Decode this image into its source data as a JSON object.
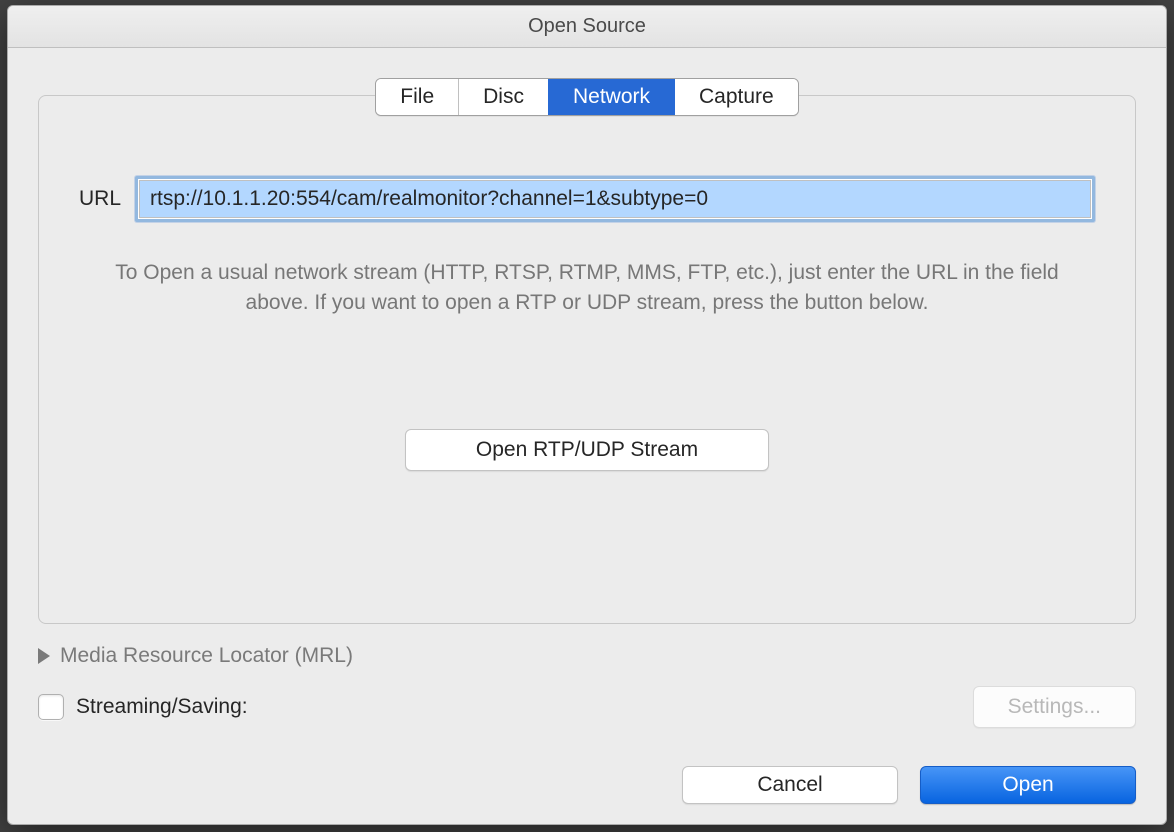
{
  "window": {
    "title": "Open Source"
  },
  "tabs": {
    "file": "File",
    "disc": "Disc",
    "network": "Network",
    "capture": "Capture"
  },
  "url": {
    "label": "URL",
    "value": "rtsp://10.1.1.20:554/cam/realmonitor?channel=1&subtype=0"
  },
  "helper": "To Open a usual network stream (HTTP, RTSP, RTMP, MMS, FTP, etc.), just enter the URL in the field above. If you want to open a RTP or UDP stream, press the button below.",
  "rtp_button": "Open RTP/UDP Stream",
  "mrl": {
    "label": "Media Resource Locator (MRL)"
  },
  "streaming": {
    "label": "Streaming/Saving:",
    "settings": "Settings..."
  },
  "buttons": {
    "cancel": "Cancel",
    "open": "Open"
  }
}
